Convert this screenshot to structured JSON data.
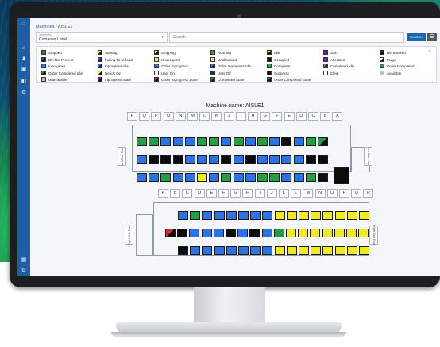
{
  "colors": {
    "Stopped": "#2f7d32",
    "Starting": "#f2ee3a|#111",
    "Stopping": "#f2ee3a|#111",
    "Running": "#1fa83a",
    "Idle": "#f2ee3a|#111",
    "Jam": "#6a1fb5",
    "Bin Blocked": "#4a1a8f|#111",
    "Bin Not Present": "#6a1fb5|#111",
    "Failing To Unload": "#2a5bd7|#111",
    "Unoccupied": "#f2ee3a",
    "Unallocated": "#e8ef6a",
    "Occupied": "#111111",
    "Allocated": "#6a1fb5",
    "Purge": "#ffffff|#111",
    "Inprogress": "#2a73e8",
    "Inprogress Idle": "#2a73e8|#111",
    "Order Inprogress": "#2a73e8",
    "Order Inprogress Idle": "#2a73e8|#111",
    "Completed": "#3aa34a",
    "Completed Idle": "#3aa34a|#111",
    "Order Completed": "#2f8f3f",
    "Order Completed Idle": "#2f8f3f|#111",
    "Needs Qc": "#f2ee3a|#111",
    "User On": "#ffffff",
    "User Off": "#1a2e7a",
    "Suppress": "#111111",
    "Clear": "#ffffff",
    "Available": "#bfbfbf",
    "Unavailable": "#bfbfbf",
    "Inprogress State": "#6a1fb5|#111",
    "Order Inprogress State": "#cc2a2a|#111",
    "Completed State": "#2f8f3f|#111",
    "Order Completed State": "#2f8f3f|#111",
    "blue": "#2a73e8",
    "green": "#23a042",
    "black": "#0c0c0c",
    "yellow": "#f0ec1c",
    "white": "#ffffff",
    "red": "#d23030"
  },
  "breadcrumb": {
    "root": "Machines",
    "sep": "/",
    "current": "AISLE1"
  },
  "search": {
    "select_label": "Search By",
    "select_value": "Container Label",
    "placeholder": "Search",
    "button": "SEARCH"
  },
  "legend": {
    "close": "×",
    "items": [
      "Stopped",
      "Starting",
      "Stopping",
      "Running",
      "Idle",
      "Jam",
      "Bin Blocked",
      "Bin Not Present",
      "Failing To Unload",
      "Unoccupied",
      "Unallocated",
      "Occupied",
      "Allocated",
      "Purge",
      "Inprogress",
      "Inprogress Idle",
      "Order Inprogress",
      "Order Inprogress Idle",
      "Completed",
      "Completed Idle",
      "Order Completed",
      "Order Completed Idle",
      "Needs Qc",
      "User On",
      "User Off",
      "Suppress",
      "Clear",
      "Available",
      "Unavailable",
      "Inprogress State",
      "Order Inprogress State",
      "Completed State",
      "Order Completed State"
    ]
  },
  "machine": {
    "title": "Machine name: AISLE1",
    "top_labels": [
      "R",
      "Q",
      "P",
      "O",
      "N",
      "M",
      "L",
      "K",
      "J",
      "I",
      "H",
      "G",
      "F",
      "E",
      "D",
      "C",
      "B",
      "A"
    ],
    "bottom_labels": [
      "A",
      "B",
      "C",
      "D",
      "E",
      "F",
      "G",
      "H",
      "I",
      "J",
      "K",
      "L",
      "M",
      "N",
      "O",
      "P",
      "Q",
      "R"
    ],
    "left_side": "Left Side\nFlow",
    "right_side_top": "Left Side\nFlow",
    "right_side_bottom": "Right Side\nFlow",
    "left_side_bottom": "Right Side\nFlow",
    "top_rows": [
      [
        "green",
        "green",
        "blue",
        "blue",
        "blue",
        "green",
        "green",
        "blue",
        "green",
        "blue",
        "green",
        "blue",
        "black",
        "blue",
        "green",
        "green-black"
      ],
      [
        "blue",
        "black",
        "black",
        "black",
        "blue",
        "blue",
        "blue",
        "black",
        "blue",
        "black",
        "blue",
        "blue",
        "blue",
        "blue",
        "black",
        "black"
      ],
      [
        "blue",
        "blue",
        "green",
        "blue",
        "blue",
        "yellow",
        "blue",
        "green",
        "blue",
        "blue",
        "green",
        "green",
        "blue",
        "blue",
        "green",
        "black"
      ]
    ],
    "bottom_rows": [
      [
        "blue",
        "green",
        "blue",
        "blue",
        "blue",
        "blue",
        "blue",
        "blue",
        "yellow",
        "yellow",
        "yellow",
        "yellow",
        "yellow",
        "yellow",
        "yellow",
        "yellow"
      ],
      [
        "red-black",
        "black",
        "blue",
        "blue",
        "blue",
        "black",
        "blue",
        "black",
        "blue",
        "green",
        "yellow",
        "yellow",
        "yellow",
        "yellow",
        "yellow",
        "yellow",
        "yellow"
      ],
      [
        "black",
        "blue",
        "blue",
        "blue",
        "blue",
        "blue",
        "blue",
        "blue",
        "yellow",
        "yellow",
        "yellow",
        "yellow",
        "yellow",
        "yellow",
        "yellow",
        "yellow"
      ]
    ]
  }
}
